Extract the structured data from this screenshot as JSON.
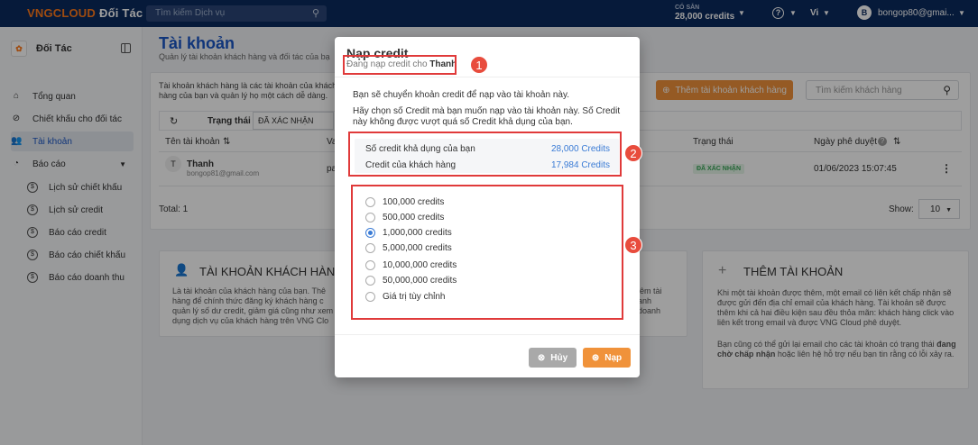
{
  "topbar": {
    "logo_brand": "VNGCLOUD",
    "logo_partner": "Đối Tác",
    "search_placeholder": "Tìm kiếm Dịch vụ",
    "credits_caption": "CÓ SẴN",
    "credits_value": "28,000 credits",
    "help": "?",
    "language": "Vi",
    "user_initial": "B",
    "user_email": "bongop80@gmai..."
  },
  "sidebar": {
    "title": "Đối Tác",
    "items": [
      {
        "label": "Tổng quan",
        "icon": "home-icon"
      },
      {
        "label": "Chiết khấu cho đối tác",
        "icon": "percent-icon"
      },
      {
        "label": "Tài khoản",
        "icon": "users-icon",
        "active": true
      },
      {
        "label": "Báo cáo",
        "icon": "chart-icon"
      }
    ],
    "subitems": [
      {
        "label": "Lịch sử chiết khấu"
      },
      {
        "label": "Lịch sử credit"
      },
      {
        "label": "Báo cáo credit"
      },
      {
        "label": "Báo cáo chiết khấu"
      },
      {
        "label": "Báo cáo doanh thu"
      }
    ]
  },
  "page": {
    "title": "Tài khoản",
    "subtitle": "Quản lý tài khoản khách hàng và đối tác của bạ",
    "desc": "Tài khoản khách hàng là các tài khoản của khách hàng của bạn và quản lý họ một cách dễ dàng.",
    "add_button": "Thêm tài khoản khách hàng",
    "search_placeholder": "Tìm kiếm khách hàng",
    "filter_label": "Trạng thái",
    "filter_value": "ĐÃ XÁC NHẬN",
    "columns": [
      "Tên tài khoản",
      "Va",
      "Trạng thái",
      "Ngày phê duyệt"
    ],
    "row": {
      "initial": "T",
      "name": "Thanh",
      "email": "bongop81@gmail.com",
      "partial": "pa",
      "status": "ĐÃ XÁC NHẬN",
      "date": "01/06/2023 15:07:45"
    },
    "total": "Total: 1",
    "show_label": "Show:",
    "show_value": "10",
    "panel_left_title": "TÀI KHOẢN KHÁCH HÀNG",
    "panel_left_text": "Là tài khoản của khách hàng của bạn. Thê hàng để chính thức đăng ký khách hàng c quản lý số dư credit, giảm giá cũng như xem dụng dịch vụ của khách hàng trên VNG Clo",
    "panel_mid_text": "iêm tài anh doanh",
    "panel_right_title": "THÊM TÀI KHOẢN",
    "panel_right_text": "Khi một tài khoản được thêm, một email có liên kết chấp nhận sẽ được gửi đến địa chỉ email của khách hàng. Tài khoản sẽ được thêm khi cả hai điều kiện sau đều thỏa mãn: khách hàng click vào liên kết trong email và được VNG Cloud phê duyệt.",
    "panel_right_text2_pre": "Bạn cũng có thể gửi lại email cho các tài khoản có trạng thái ",
    "panel_right_text2_bold": "đang chờ chấp nhận",
    "panel_right_text2_post": " hoặc liên hệ hỗ trợ nếu bạn tin rằng có lỗi xảy ra."
  },
  "modal": {
    "title": "Nạp credit",
    "subtitle_pre": "Đang nạp credit cho ",
    "subtitle_name": "Thanh",
    "text1": "Bạn sẽ chuyển khoản credit để nạp vào tài khoản này.",
    "text2": "Hãy chọn số Credit mà bạn muốn nạp vào tài khoản này. Số Credit này không được vượt quá số Credit khả dụng của bạn.",
    "available_label": "Số credit khả dụng của bạn",
    "available_value": "28,000 Credits",
    "customer_label": "Credit của khách hàng",
    "customer_value": "17,984 Credits",
    "options": [
      "100,000 credits",
      "500,000 credits",
      "1,000,000 credits",
      "5,000,000 credits",
      "10,000,000 credits",
      "50,000,000 credits",
      "Giá trị tùy chỉnh"
    ],
    "selected_index": 2,
    "cancel": "Hủy",
    "submit": "Nạp"
  },
  "annotations": [
    "1",
    "2",
    "3"
  ]
}
